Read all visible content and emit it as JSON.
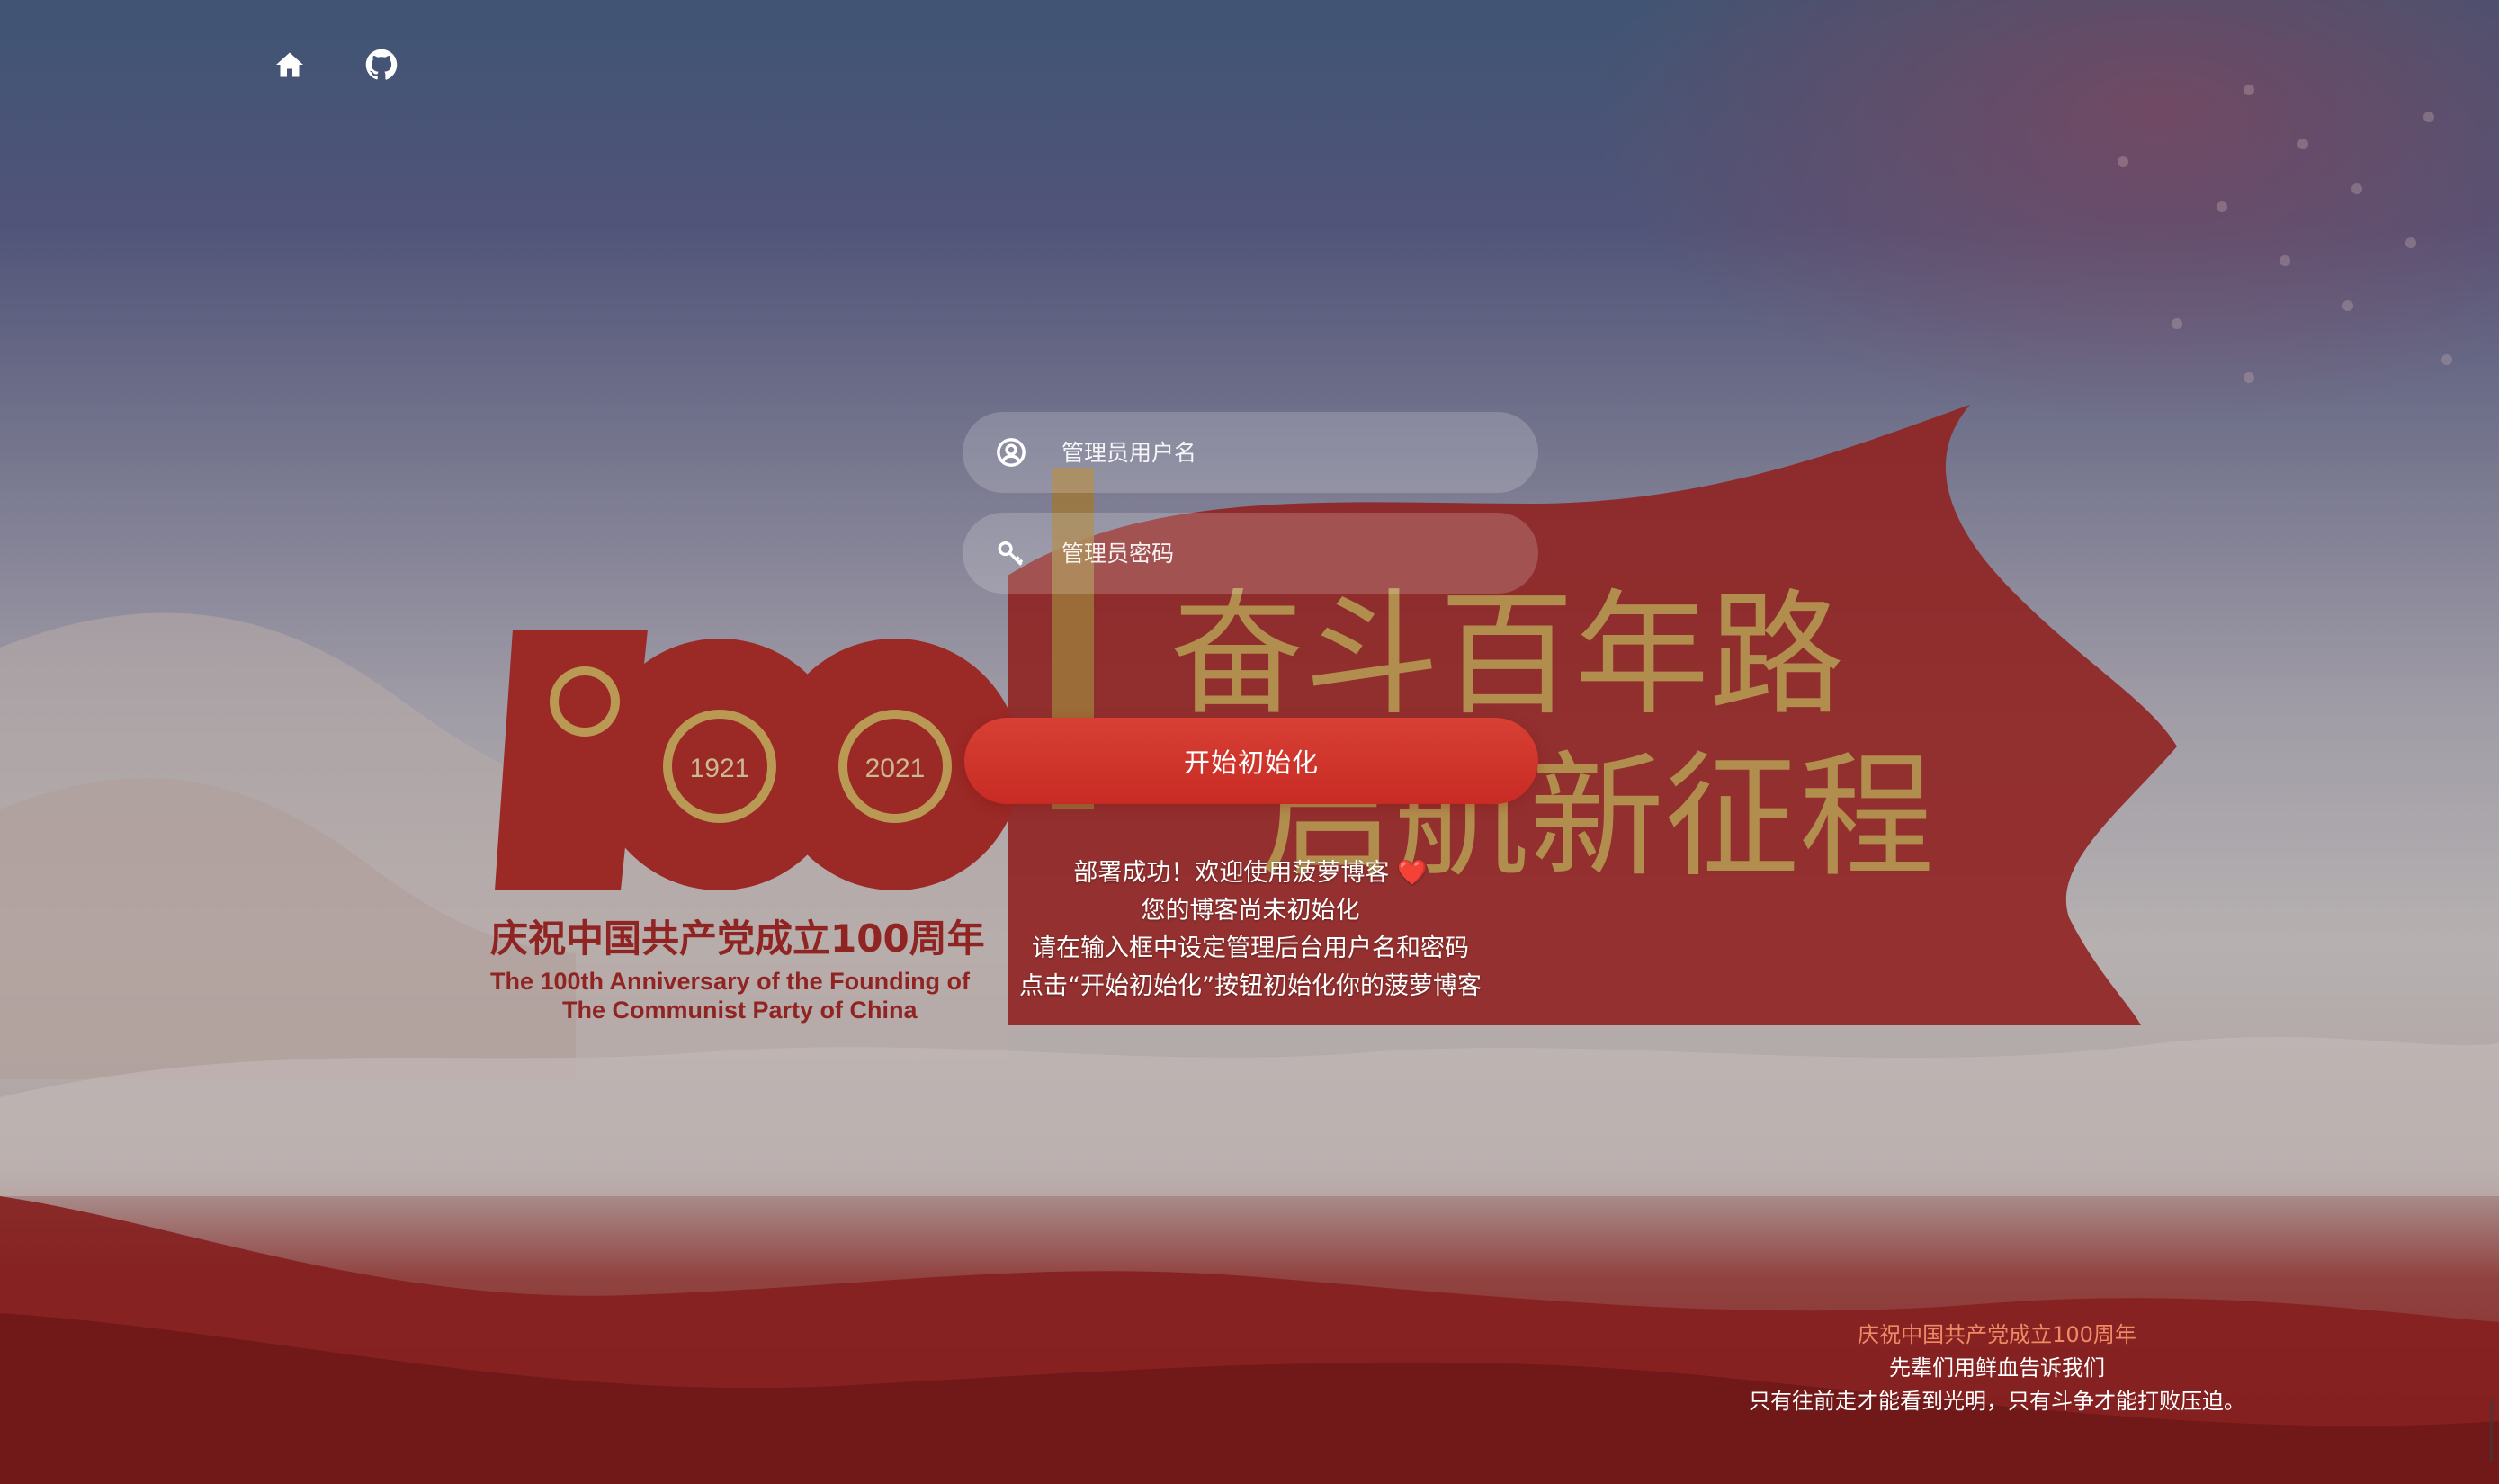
{
  "nav": {
    "home_icon": "home-icon",
    "github_icon": "github-icon"
  },
  "form": {
    "username": {
      "placeholder": "管理员用户名",
      "value": "",
      "icon": "user-circle-icon"
    },
    "password": {
      "placeholder": "管理员密码",
      "value": "",
      "icon": "key-icon"
    },
    "submit_label": "开始初始化"
  },
  "messages": {
    "line1": "部署成功！欢迎使用菠萝博客",
    "heart": "❤️",
    "line2": "您的博客尚未初始化",
    "line3": "请在输入框中设定管理后台用户名和密码",
    "line4": "点击“开始初始化”按钮初始化你的菠萝博客"
  },
  "background_art": {
    "banner_text": "奋斗百年路 启航新征程",
    "emblem_number": "100",
    "emblem_years": [
      "1921",
      "2021"
    ],
    "caption_cn": "庆祝中国共产党成立100周年",
    "caption_en_1": "The 100th Anniversary of the Founding of",
    "caption_en_2": "The Communist Party of China"
  },
  "footer": {
    "quote_title": "庆祝中国共产党成立100周年",
    "quote_line1": "先辈们用鲜血告诉我们",
    "quote_line2": "只有往前走才能看到光明，只有斗争才能打败压迫。"
  },
  "colors": {
    "accent_red": "#c82b24",
    "quote_title": "#f08a66"
  }
}
